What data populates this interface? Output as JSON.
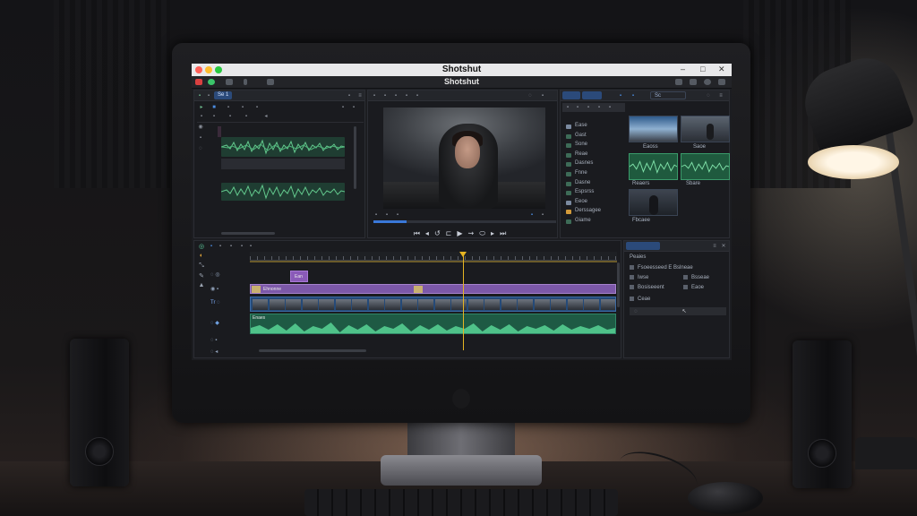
{
  "app": {
    "window_title": "Shotshut",
    "header_title": "Shotshut"
  },
  "source_panel": {
    "tab_label": "Se 1"
  },
  "program_panel": {
    "playback_progress": 0.18
  },
  "media_browser": {
    "tabs": [
      "",
      ""
    ],
    "search_tab": "Sc",
    "bins": [
      {
        "label": "Ease",
        "kind": "doc"
      },
      {
        "label": "Gast",
        "kind": "clip"
      },
      {
        "label": "Sone",
        "kind": "clip"
      },
      {
        "label": "Reae",
        "kind": "clip"
      },
      {
        "label": "Dasnes",
        "kind": "clip"
      },
      {
        "label": "Fnne",
        "kind": "clip"
      },
      {
        "label": "Dasne",
        "kind": "clip"
      },
      {
        "label": "Espsrss",
        "kind": "clip"
      },
      {
        "label": "Eeoe",
        "kind": "doc"
      },
      {
        "label": "Derssagee",
        "kind": "folder"
      },
      {
        "label": "Giame",
        "kind": "clip"
      }
    ],
    "thumbnails": [
      {
        "label": "Eaoss"
      },
      {
        "label": "Saoe"
      },
      {
        "label": "Reaers"
      },
      {
        "label": "Sbare"
      },
      {
        "label": "Fbcaee"
      }
    ]
  },
  "timeline": {
    "clips": {
      "title_clip": "Ean",
      "v2_clip": "Ehnonne",
      "a1_clip": "Enaes"
    },
    "tools": [
      "◎",
      "◐",
      "⤡",
      "✎",
      "▲"
    ]
  },
  "properties_panel": {
    "header": "Peaies",
    "rows": [
      "Fsoeesseed E Bslneae",
      "Iwse",
      "Bosiseeent",
      "Ceae"
    ],
    "right_values": [
      "",
      "Bsseae",
      "Eaoe"
    ]
  }
}
